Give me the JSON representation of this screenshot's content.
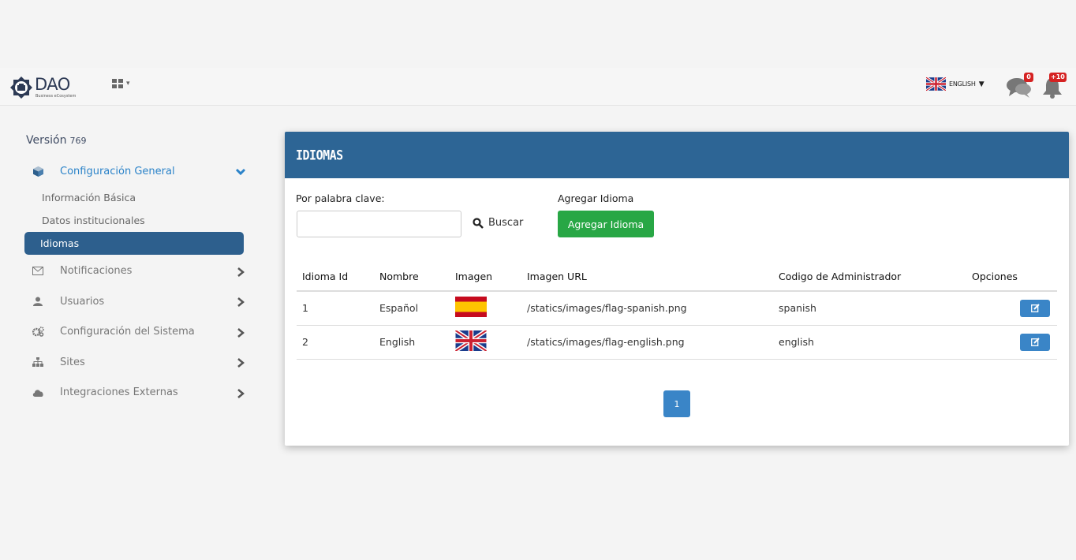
{
  "header": {
    "logo_text": "DAO",
    "logo_sub": "Business eCosystem",
    "language": "ENGLISH",
    "chat_count": "0",
    "notification_count": "+10"
  },
  "sidebar": {
    "version_label": "Versión",
    "version_number": "769",
    "active_section": "Configuración General",
    "sub_items": [
      "Información Básica",
      "Datos institucionales",
      "Idiomas"
    ],
    "items": [
      "Notificaciones",
      "Usuarios",
      "Configuración del Sistema",
      "Sites",
      "Integraciones Externas"
    ]
  },
  "panel": {
    "title": "IDIOMAS",
    "keyword_label": "Por palabra clave:",
    "keyword_value": "",
    "search_label": "Buscar",
    "add_label": "Agregar Idioma",
    "add_button": "Agregar Idioma"
  },
  "table": {
    "headers": [
      "Idioma Id",
      "Nombre",
      "Imagen",
      "Imagen URL",
      "Codigo de Administrador",
      "Opciones"
    ],
    "rows": [
      {
        "id": "1",
        "name": "Español",
        "flag": "spain-flag",
        "url": "/statics/images/flag-spanish.png",
        "code": "spanish"
      },
      {
        "id": "2",
        "name": "English",
        "flag": "uk-flag",
        "url": "/statics/images/flag-english.png",
        "code": "english"
      }
    ]
  },
  "pagination": {
    "current": "1"
  },
  "colors": {
    "header_blue": "#2d6595",
    "accent_blue": "#3a85c7",
    "active_green": "#28a745",
    "sidebar_selected": "#2d5f8d"
  }
}
